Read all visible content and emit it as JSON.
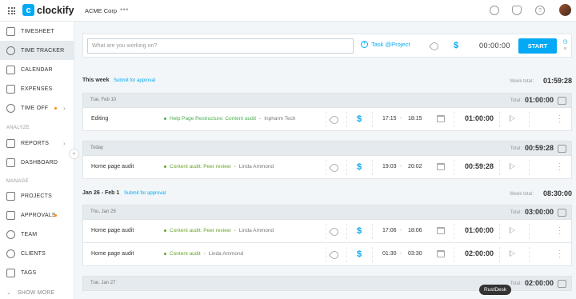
{
  "topbar": {
    "app_name": "clockify",
    "logo_letter": "c",
    "workspace": "ACME Corp",
    "more": "•••",
    "icons": [
      "puzzle-icon",
      "bell-icon",
      "help-icon"
    ]
  },
  "sidebar": {
    "sections": {
      "analyze": "ANALYZE",
      "manage": "MANAGE"
    },
    "items": [
      {
        "label": "Timesheet",
        "icon": "timesheet-icon"
      },
      {
        "label": "Time Tracker",
        "icon": "clock-icon",
        "active": true
      },
      {
        "label": "Calendar",
        "icon": "calendar-icon"
      },
      {
        "label": "Expenses",
        "icon": "receipt-icon"
      },
      {
        "label": "Time Off",
        "icon": "time-off-icon"
      },
      {
        "label": "Reports",
        "icon": "reports-icon"
      },
      {
        "label": "Dashboard",
        "icon": "dashboard-icon"
      },
      {
        "label": "Projects",
        "icon": "projects-icon"
      },
      {
        "label": "Approvals",
        "icon": "approvals-icon"
      },
      {
        "label": "Team",
        "icon": "team-icon"
      },
      {
        "label": "Clients",
        "icon": "clients-icon"
      },
      {
        "label": "Tags",
        "icon": "tag-icon"
      },
      {
        "label": "Show more",
        "icon": "chevron-down-icon"
      }
    ],
    "collapse": "«"
  },
  "timer": {
    "placeholder": "What are you working on?",
    "project_label": "Task @Project",
    "time": "00:00:00",
    "start_label": "START",
    "billable_symbol": "$"
  },
  "weeks": [
    {
      "title": "This week",
      "submit": "Submit for approval",
      "total_label": "Week total:",
      "total": "01:59:28",
      "days": [
        {
          "label": "Tue, Feb 10",
          "total_label": "Total:",
          "total": "01:00:00",
          "entries": [
            {
              "desc": "Editing",
              "project": "Help Page Restructure: Content audit",
              "project_color": "#4caf50",
              "client": "Inpharm Tech",
              "start": "17:15",
              "end": "18:15",
              "duration": "01:00:00"
            }
          ]
        },
        {
          "label": "Today",
          "total_label": "Total:",
          "total": "00:59:28",
          "entries": [
            {
              "desc": "Home page audit",
              "project": "Content audit: Peer review",
              "project_color": "#8bc34a",
              "client": "Linda Ammond",
              "start": "19:03",
              "end": "20:02",
              "duration": "00:59:28"
            }
          ]
        }
      ]
    },
    {
      "title": "Jan 26 - Feb 1",
      "submit": "Submit for approval",
      "total_label": "Week total:",
      "total": "08:30:00",
      "days": [
        {
          "label": "Thu, Jan 29",
          "total_label": "Total:",
          "total": "03:00:00",
          "entries": [
            {
              "desc": "Home page audit",
              "project": "Content audit: Peer review",
              "project_color": "#8bc34a",
              "client": "Linda Ammond",
              "start": "17:06",
              "end": "18:06",
              "duration": "01:00:00"
            },
            {
              "desc": "Home page audit",
              "project": "Content audit",
              "project_color": "#8bc34a",
              "client": "Linda Ammond",
              "start": "01:30",
              "end": "03:30",
              "duration": "02:00:00"
            }
          ]
        },
        {
          "label": "Tue, Jan 27",
          "total_label": "Total:",
          "total": "02:00:00",
          "entries": []
        }
      ]
    }
  ],
  "separator_dash": "-",
  "entry_client_prefix": " - ",
  "tooltip": "RustDesk",
  "colors": {
    "accent": "#03a9f4",
    "sidebar_active": "#e4eaee",
    "orange_dot": "#ff8a00"
  }
}
